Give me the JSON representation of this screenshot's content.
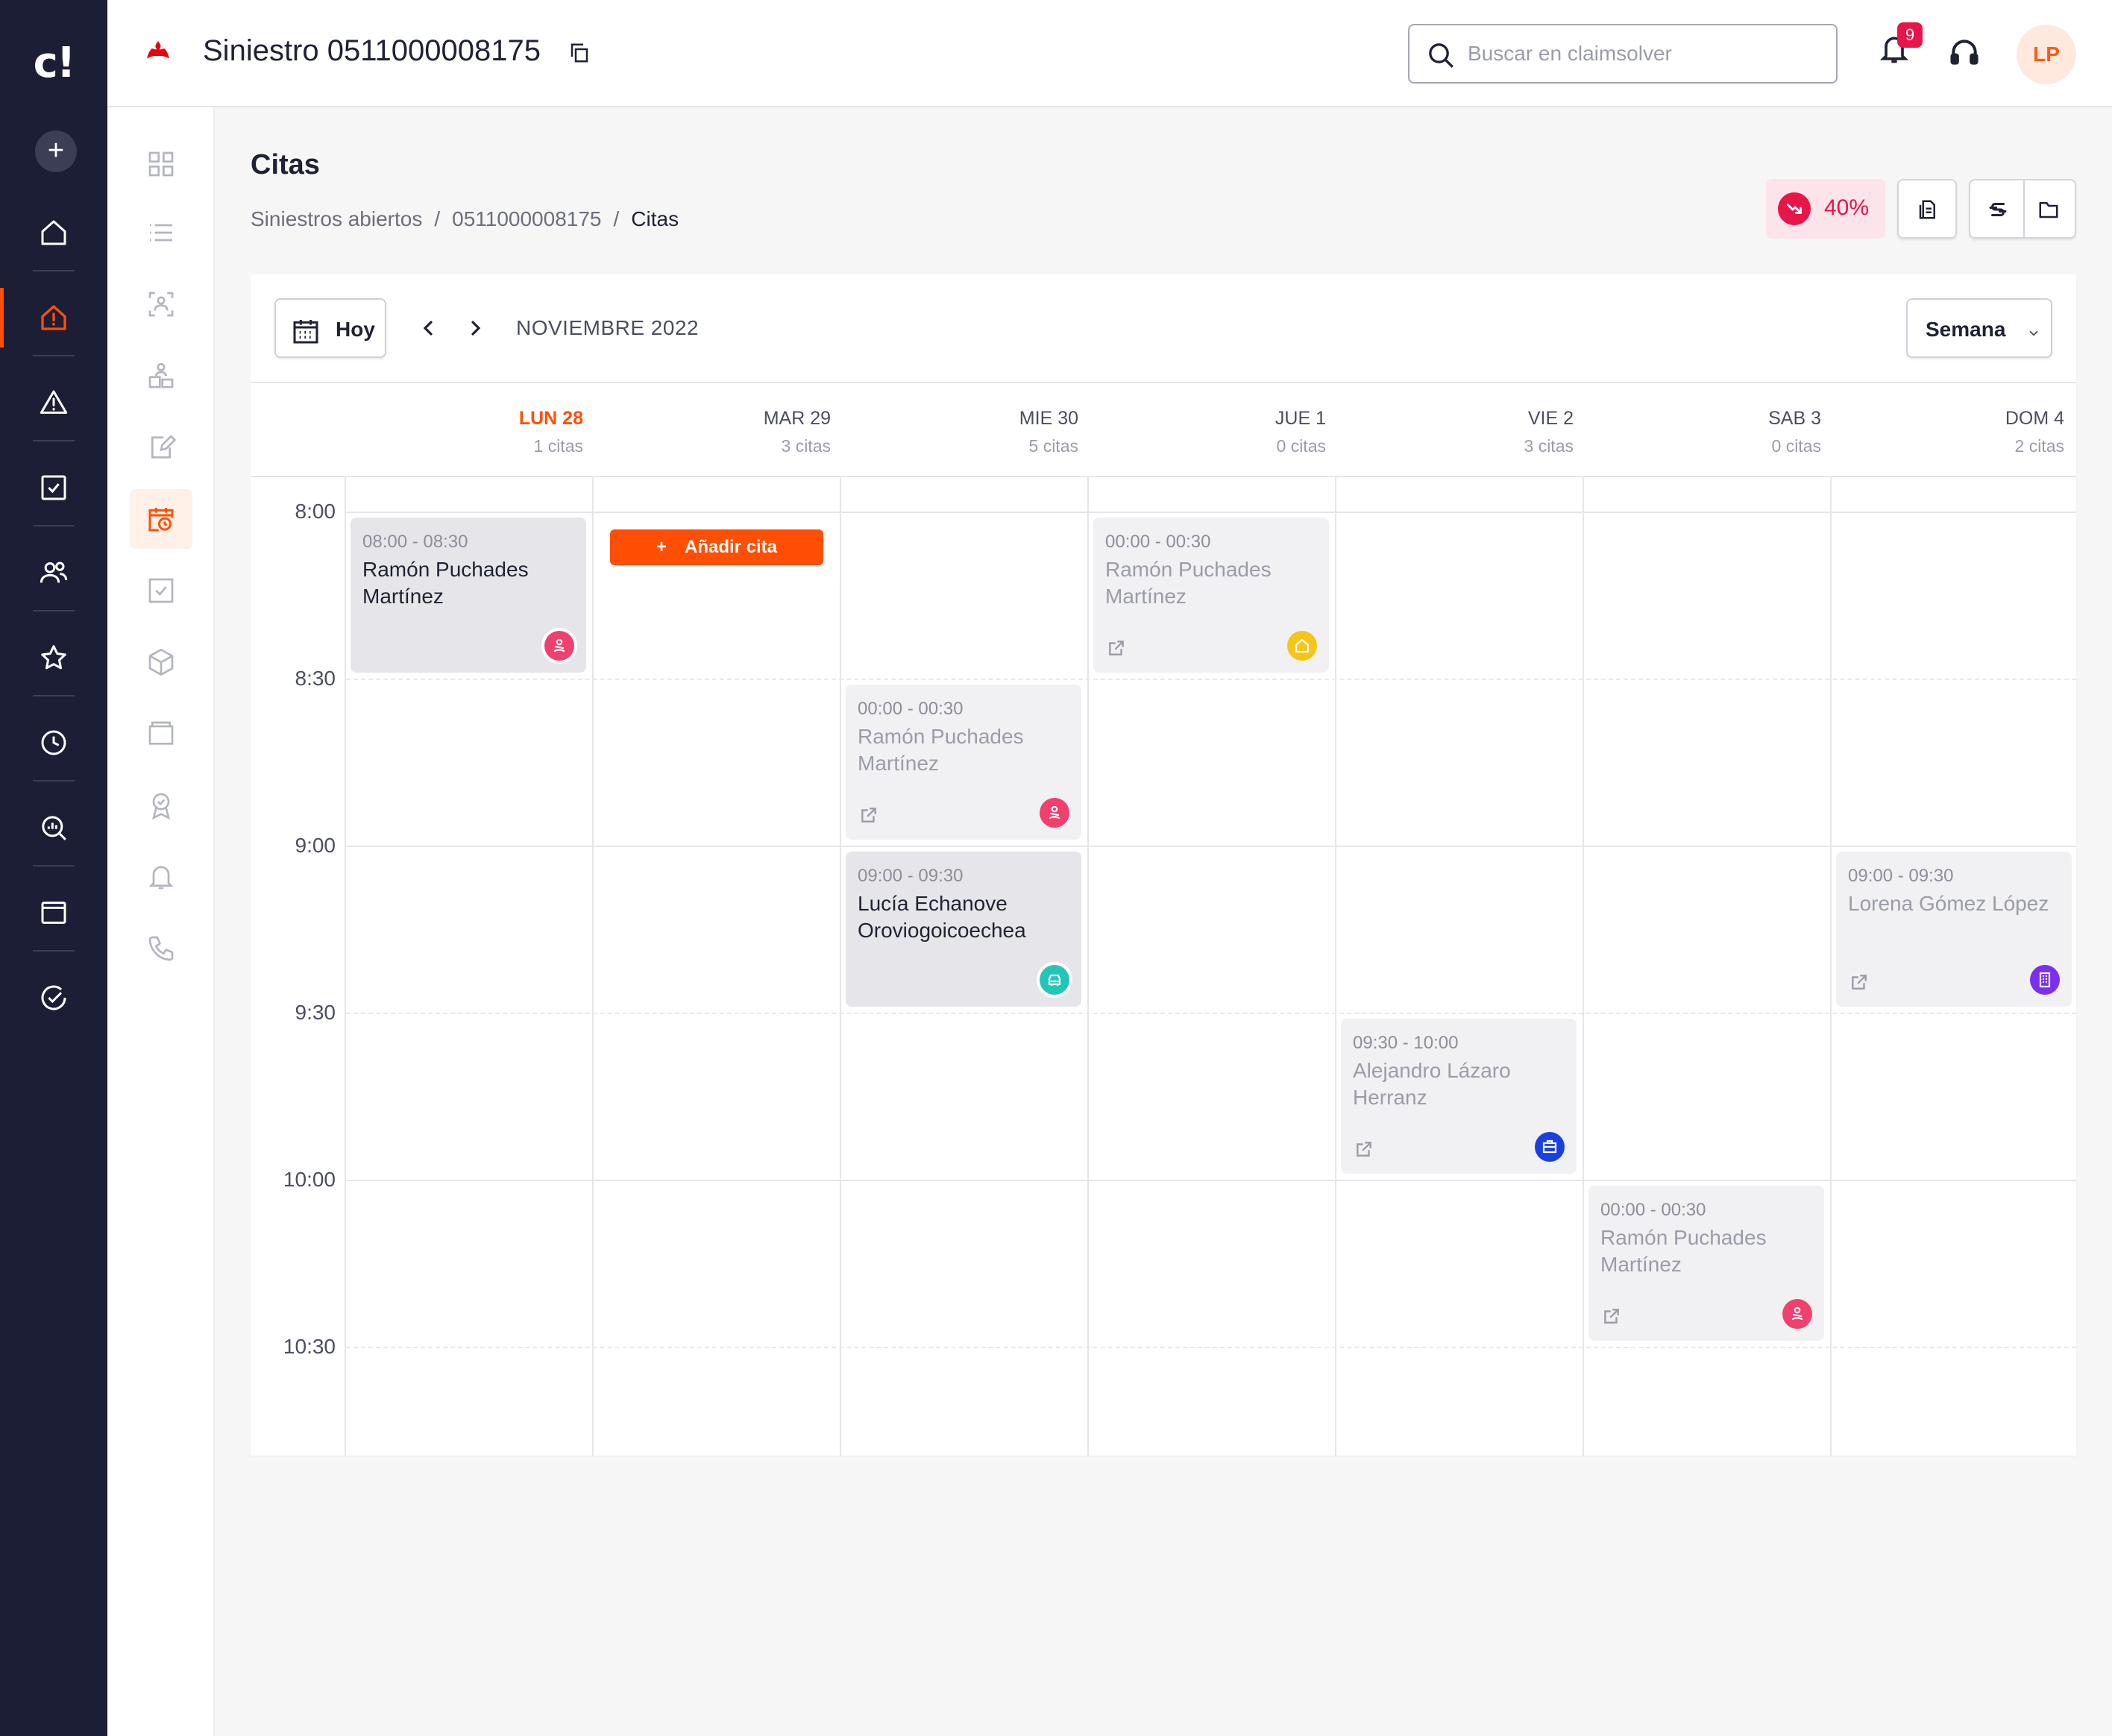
{
  "app": {
    "logo": "c!",
    "claim_title": "Siniestro 0511000008175",
    "search_placeholder": "Buscar en claimsolver",
    "notifications_count": "9",
    "user_initials": "LP"
  },
  "rail": {
    "icons": [
      "home-icon",
      "claims-alert-icon",
      "warning-icon",
      "tasks-icon",
      "users-icon",
      "star-icon",
      "clock-icon",
      "analytics-icon",
      "window-icon",
      "check-circle-icon"
    ],
    "active": "claims-alert-icon"
  },
  "subnav": {
    "icons": [
      "grid-icon",
      "list-icon",
      "people-scan-icon",
      "person-building-icon",
      "edit-doc-icon",
      "calendar-clock-icon",
      "checkbox-icon",
      "package-icon",
      "wallet-icon",
      "award-icon",
      "bell-icon",
      "phone-icon"
    ],
    "active": "calendar-clock-icon"
  },
  "page": {
    "title": "Citas",
    "breadcrumb": [
      "Siniestros abiertos",
      "0511000008175",
      "Citas"
    ],
    "breadcrumb_sep": "/",
    "progress_label": "40%",
    "progress_value": 0.4
  },
  "calendar": {
    "today_label": "Hoy",
    "month_label": "NOVIEMBRE 2022",
    "view_label": "Semana",
    "add_label": "Añadir cita",
    "add_symbol": "+",
    "days": [
      {
        "name": "LUN 28",
        "count": "1 citas",
        "today": true
      },
      {
        "name": "MAR 29",
        "count": "3 citas",
        "today": false
      },
      {
        "name": "MIE 30",
        "count": "5 citas",
        "today": false
      },
      {
        "name": "JUE 1",
        "count": "0 citas",
        "today": false
      },
      {
        "name": "VIE 2",
        "count": "3 citas",
        "today": false
      },
      {
        "name": "SAB 3",
        "count": "0 citas",
        "today": false
      },
      {
        "name": "DOM 4",
        "count": "2 citas",
        "today": false
      }
    ],
    "times": [
      "8:00",
      "8:30",
      "9:00",
      "9:30",
      "10:00",
      "10:30"
    ],
    "appointments": [
      {
        "time": "08:00 - 08:30",
        "name": "Ramón Puchades Martínez",
        "active": true,
        "category": "person-icon",
        "color": "#f0406e"
      },
      {
        "time": "00:00 - 00:30",
        "name": "Ramón Puchades Martínez",
        "active": false,
        "category": "home-icon",
        "color": "#f5c518"
      },
      {
        "time": "00:00 - 00:30",
        "name": "Ramón Puchades Martínez",
        "active": false,
        "category": "person-icon",
        "color": "#f0406e"
      },
      {
        "time": "09:00 - 09:30",
        "name": "Lucía Echanove Oroviogoicoechea",
        "active": true,
        "category": "car-icon",
        "color": "#22c6b8"
      },
      {
        "time": "09:00 - 09:30",
        "name": "Lorena Gómez López",
        "active": false,
        "category": "building-icon",
        "color": "#7b2ff0"
      },
      {
        "time": "09:30 - 10:00",
        "name": "Alejandro Lázaro Herranz",
        "active": false,
        "category": "briefcase-icon",
        "color": "#1b3fe0"
      },
      {
        "time": "00:00 - 00:30",
        "name": "Ramón Puchades Martínez",
        "active": false,
        "category": "person-icon",
        "color": "#f0406e"
      }
    ]
  }
}
